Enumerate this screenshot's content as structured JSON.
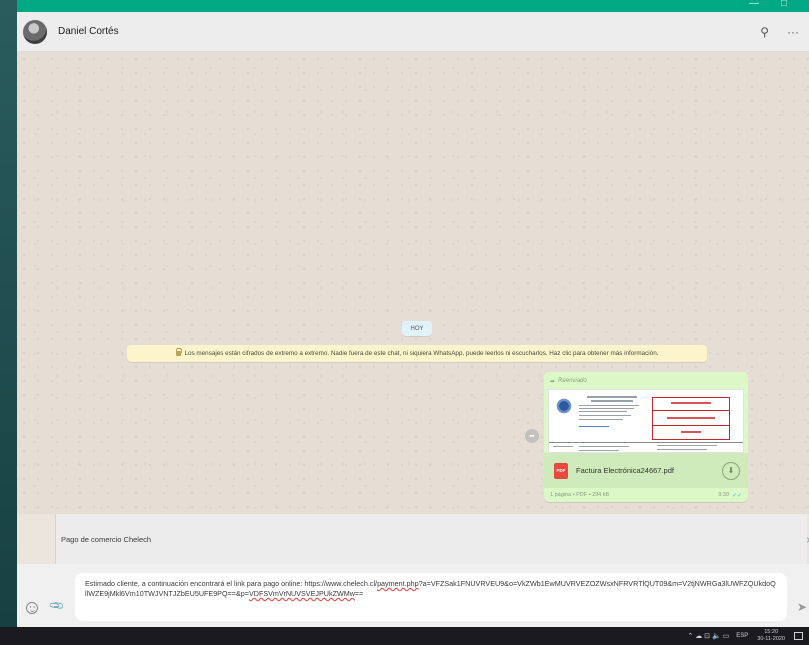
{
  "window": {
    "minimize_glyph": "—",
    "maximize_glyph": "□"
  },
  "header": {
    "contact_name": "Daniel Cortés",
    "search_icon": "search-icon",
    "menu_icon": "more-icon",
    "search_glyph": "⚲",
    "menu_glyph": "···"
  },
  "chat": {
    "day_label": "HOY",
    "encryption_notice": "Los mensajes están cifrados de extremo a extremo. Nadie fuera de este chat, ni siquiera WhatsApp, puede leerlos ni escucharlos. Haz clic para obtener más información.",
    "forward_glyph": "➦",
    "message": {
      "forwarded_label": "Reenviado",
      "forwarded_glyph": "➦",
      "file_icon_label": "PDF",
      "file_name": "Factura Electrónica24667.pdf",
      "download_glyph": "⬇",
      "file_meta": "1 página • PDF • 294 kB",
      "time": "9:30",
      "ticks": "✓✓"
    }
  },
  "quoted": {
    "text": "Pago de comercio Chelech",
    "close_glyph": "×"
  },
  "composer": {
    "text_before": "Estimado cliente, a continuación encontrará el link para pago online: https://www.chelech.cl/",
    "text_link": "payment.php",
    "text_mid": "?a=VFZSak1FNUVRVEU9&o=VkZWb1EwMUVRVEZOZWsxNFRVRTlQUT09&m=V2tjNWRGa3lUWFZQUkdoQllWZE9jMkl6Vm10TWJVNTJZbEU5UFE9PQ==&p=",
    "text_end_underlined": "VDFSVmVrNUVSVEJPUkZWMw",
    "text_tail": "==",
    "emoji_icon": "emoji-icon",
    "attach_icon": "paperclip-icon",
    "attach_glyph": "📎",
    "send_glyph": "➤"
  },
  "taskbar": {
    "tray_glyphs": "⌃ ☁ ⊡ 🔈 ▭",
    "language": "ESP",
    "time": "15:20",
    "date": "30-11-2020"
  },
  "colors": {
    "accent": "#00a884",
    "outgoing_bubble": "#dcf8c6",
    "notice_bg": "#fcf4cb",
    "pdf_red": "#e84a3f"
  }
}
